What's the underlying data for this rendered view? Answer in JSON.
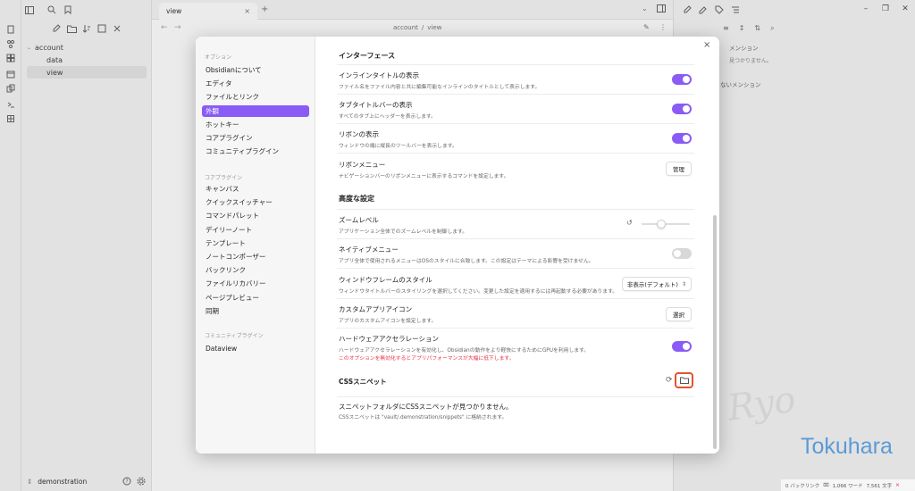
{
  "tab": {
    "title": "view"
  },
  "breadcrumb": {
    "folder": "account",
    "separator": "/",
    "note": "view"
  },
  "tree": {
    "folder": "account",
    "files": [
      "data",
      "view"
    ]
  },
  "vault": {
    "name": "demonstration"
  },
  "settings": {
    "nav": {
      "options_header": "オプション",
      "options": [
        "Obsidianについて",
        "エディタ",
        "ファイルとリンク",
        "外観",
        "ホットキー",
        "コアプラグイン",
        "コミュニティプラグイン"
      ],
      "active_index": 3,
      "core_header": "コアプラグイン",
      "core": [
        "キャンバス",
        "クイックスイッチャー",
        "コマンドパレット",
        "デイリーノート",
        "テンプレート",
        "ノートコンポーザー",
        "バックリンク",
        "ファイルリカバリー",
        "ページプレビュー",
        "同期"
      ],
      "community_header": "コミュニティプラグイン",
      "community": [
        "Dataview"
      ]
    },
    "section_interface": "インターフェース",
    "inline_title": {
      "name": "インラインタイトルの表示",
      "desc": "ファイル名をファイル内容と共に編集可能なインラインのタイトルとして表示します。"
    },
    "tab_title_bar": {
      "name": "タブタイトルバーの表示",
      "desc": "すべてのタブ上にヘッダーを表示します。"
    },
    "ribbon_show": {
      "name": "リボンの表示",
      "desc": "ウィンドウの端に縦長のツールバーを表示します。"
    },
    "ribbon_menu": {
      "name": "リボンメニュー",
      "desc": "ナビゲーションバーのリボンメニューに表示するコマンドを設定します。",
      "button": "管理"
    },
    "section_advanced": "高度な設定",
    "zoom": {
      "name": "ズームレベル",
      "desc": "アプリケーション全体でのズームレベルを制御します。",
      "level": 0.4
    },
    "native_menu": {
      "name": "ネイティブメニュー",
      "desc": "アプリ全体で使用されるメニューはOSのスタイルに合致します。この設定はテーマによる影響を受けません。"
    },
    "window_frame": {
      "name": "ウィンドウフレームのスタイル",
      "desc": "ウィンドウタイトルバーのスタイリングを選択してください。変更した設定を適用するには再起動する必要があります。",
      "value": "非表示(デフォルト)"
    },
    "custom_icon": {
      "name": "カスタムアプリアイコン",
      "desc": "アプリのカスタムアイコンを設定します。",
      "button": "選択"
    },
    "hw_accel": {
      "name": "ハードウェアアクセラレーション",
      "desc": "ハードウェアアクセラレーションを有効化し、Obsidianの動作をより軽快にするためにGPUを利用します。",
      "warning": "このオプションを無効化するとアプリパフォーマンスが大幅に低下します。"
    },
    "css_snippets": {
      "title": "CSSスニペット",
      "empty": "スニペットフォルダにCSSスニペットが見つかりません。",
      "path_desc": "CSSスニペットは \"vault/.demonstration/snippets\" に格納されます。"
    }
  },
  "right_panel": {
    "line1": "メンション",
    "line2": "見つかりません。",
    "line3": "ないメンション"
  },
  "statusbar": {
    "backlinks": "0 バックリンク",
    "words": "1,066 ワード",
    "chars": "7,561 文字"
  },
  "watermark": {
    "script": "Ryo",
    "name": "Tokuhara"
  },
  "colors": {
    "accent": "#8a5cf5",
    "highlight": "#e5532b",
    "warning": "#e93147"
  }
}
